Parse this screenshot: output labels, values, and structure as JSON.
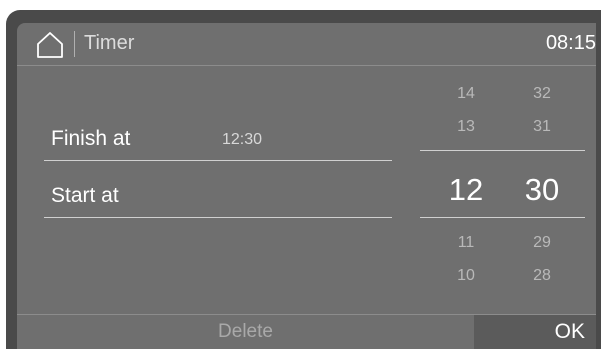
{
  "header": {
    "home_icon": "home-icon",
    "title": "Timer",
    "clock": "08:15"
  },
  "rows": {
    "finish": {
      "label": "Finish at",
      "value": "12:30"
    },
    "start": {
      "label": "Start at"
    }
  },
  "picker": {
    "hours": {
      "above": [
        "14",
        "13"
      ],
      "selected": "12",
      "below": [
        "11",
        "10"
      ]
    },
    "minutes": {
      "above": [
        "32",
        "31"
      ],
      "selected": "30",
      "below": [
        "29",
        "28"
      ]
    }
  },
  "footer": {
    "delete_label": "Delete",
    "ok_label": "OK"
  },
  "colors": {
    "bezel": "#4a4a4a",
    "screen": "#6f6f6f",
    "ok_button": "#5b5b5b"
  }
}
